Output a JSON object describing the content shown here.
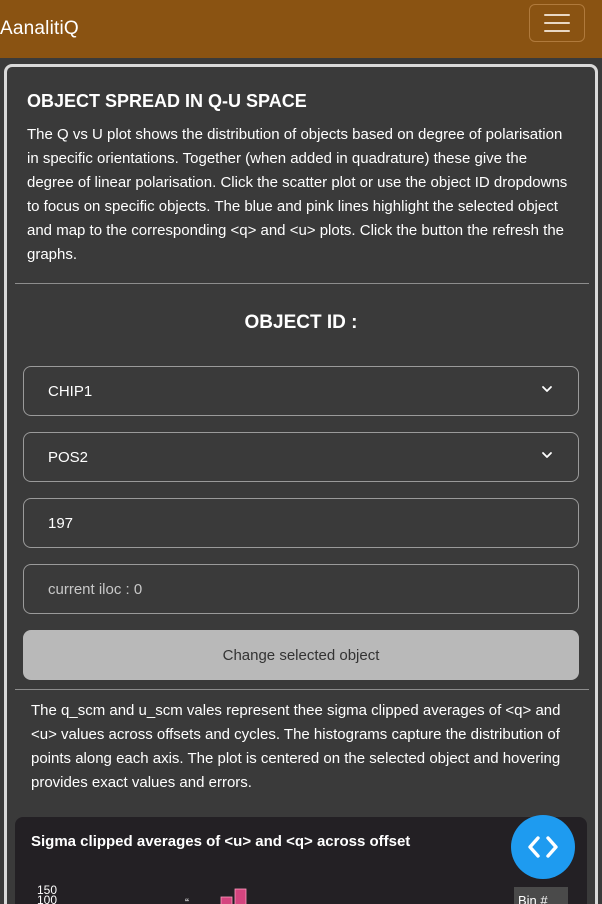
{
  "navbar": {
    "brand": "AanalitiQ",
    "toggle_icon": "hamburger-menu-icon"
  },
  "section": {
    "title": "OBJECT SPREAD IN Q-U SPACE",
    "intro": "The Q vs U plot shows the distribution of objects based on degree of polarisation in specific orientations. Together (when added in quadrature) these give the degree of linear polarisation. Click the scatter plot or use the object ID dropdowns to focus on specific objects. The blue and pink lines highlight the selected object and map to the corresponding <q> and <u> plots. Click the button the refresh the graphs."
  },
  "object_id": {
    "label": "OBJECT ID :",
    "chip_select": "CHIP1",
    "pos_select": "POS2",
    "id_value": "197",
    "iloc_placeholder": "current iloc : 0",
    "button_label": "Change selected object"
  },
  "description": "The q_scm and u_scm vales represent thee sigma clipped averages of <q> and <u> values across offsets and cycles. The histograms capture the distribution of points along each axis. The plot is centered on the selected object and hovering provides exact values and errors.",
  "chart": {
    "title": "Sigma clipped averages of <u> and <q> across offset",
    "ytick_top": "150",
    "ytick_second": "100",
    "legend_label": "Bin #",
    "fab_icon": "code-brackets-icon",
    "colors": {
      "bar": "#d4457f",
      "fab": "#1e9bf0",
      "card": "#232024"
    }
  }
}
